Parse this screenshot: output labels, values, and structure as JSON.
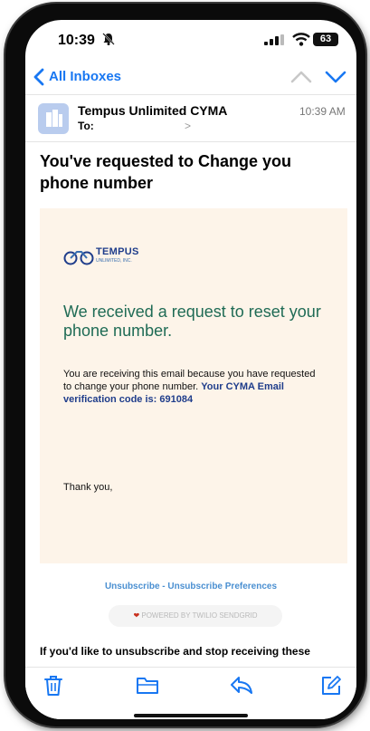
{
  "status_bar": {
    "time": "10:39",
    "battery": "63"
  },
  "nav": {
    "back_label": "All Inboxes"
  },
  "header": {
    "sender": "Tempus Unlimited CYMA",
    "to_label": "To:",
    "to_chevron": ">",
    "time": "10:39 AM"
  },
  "subject": "You've requested to Change you phone number",
  "email": {
    "logo_text": "TEMPUS",
    "logo_sub": "UNLIMITED, INC.",
    "heading": "We received a request to reset your phone number.",
    "body": "You are receiving this email because you have requested to change your phone number. ",
    "code_text": "Your CYMA Email verification code is: 691084",
    "thanks": "Thank you,"
  },
  "footer": {
    "unsubscribe": "Unsubscribe - Unsubscribe Preferences",
    "powered_by": "POWERED BY TWILIO SENDGRID",
    "text": "If you'd like to unsubscribe and stop receiving these"
  },
  "colors": {
    "accent": "#1877f2",
    "heading_green": "#1f6b55",
    "card_bg": "#fdf4e9",
    "link": "#4a8fd1"
  },
  "icons": [
    "bell-icon",
    "signal-icon",
    "wifi-icon",
    "back-chevron-icon",
    "chevron-up-icon",
    "chevron-down-icon",
    "building-icon",
    "heart-icon",
    "trash-icon",
    "folder-icon",
    "reply-icon",
    "compose-icon"
  ]
}
